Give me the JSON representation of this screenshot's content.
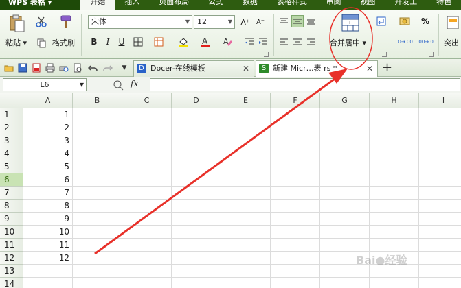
{
  "menubar": {
    "app_label": "WPS 表格",
    "tabs": [
      "开始",
      "插入",
      "页面布局",
      "公式",
      "数据",
      "表格样式",
      "审阅",
      "视图",
      "开发工",
      "特色"
    ]
  },
  "ribbon": {
    "paste_label": "粘贴",
    "format_painter_label": "格式刷",
    "font_name": "宋体",
    "font_size": "12",
    "merge_center_label": "合并居中",
    "highlight_label": "突出",
    "bold": "B",
    "italic": "I",
    "underline": "U",
    "grow_font": "A⁺",
    "shrink_font": "A⁻",
    "percent": "%",
    "inc_decimal": ".0→.00",
    "dec_decimal": ".00→.0"
  },
  "doc_tabs": [
    {
      "label": "Docer-在线模板",
      "active": false
    },
    {
      "label": "新建 Micr…表  rs *",
      "active": true
    }
  ],
  "formula_bar": {
    "cell_ref": "L6",
    "fx_label": "fx"
  },
  "grid": {
    "columns": [
      "A",
      "B",
      "C",
      "D",
      "E",
      "F",
      "G",
      "H",
      "I"
    ],
    "rows": [
      "1",
      "2",
      "3",
      "4",
      "5",
      "6",
      "7",
      "8",
      "9",
      "10",
      "11",
      "12",
      "13",
      "14"
    ],
    "col_a_values": [
      "1",
      "2",
      "3",
      "4",
      "5",
      "6",
      "7",
      "8",
      "9",
      "10",
      "11",
      "12",
      "",
      ""
    ],
    "selected_row": "6"
  },
  "annotation": {
    "arrow_color": "#e8312a",
    "circle_color": "#e8312a"
  },
  "watermark": "Bai●经验"
}
